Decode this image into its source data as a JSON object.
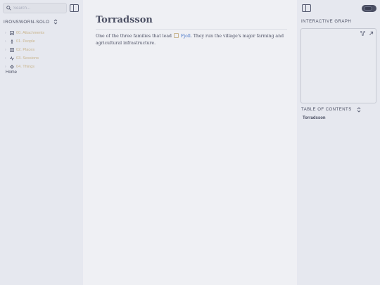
{
  "left_sidebar": {
    "search_placeholder": "Search...",
    "vault_name": "IRONSWORN-SOLO",
    "tree": [
      {
        "label": "00. Attachments",
        "icon": "image-icon"
      },
      {
        "label": "01. People",
        "icon": "person-icon"
      },
      {
        "label": "02. Places",
        "icon": "map-icon"
      },
      {
        "label": "03. Sessions",
        "icon": "pulse-icon"
      },
      {
        "label": "04. Things",
        "icon": "gear-icon"
      }
    ],
    "home_label": "Home"
  },
  "note": {
    "title": "Torradsson",
    "text_before": "One of the three families that lead",
    "link_text": "Fjoll",
    "text_after": ". They run the village's major farming and agricultural infrastructure."
  },
  "right_sidebar": {
    "graph_label": "INTERACTIVE GRAPH",
    "toc_label": "TABLE OF CONTENTS",
    "toc_items": [
      "Torradsson"
    ]
  },
  "colors": {
    "accent_link": "#4a78c9",
    "folder_text": "#c9b58e",
    "text": "#4b4f63"
  }
}
